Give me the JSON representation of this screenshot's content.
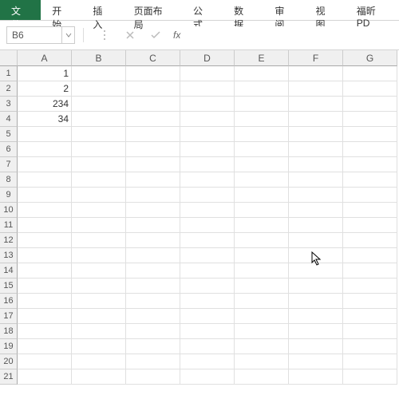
{
  "menu": {
    "file": "文件",
    "home": "开始",
    "insert": "插入",
    "layout": "页面布局",
    "formula": "公式",
    "data": "数据",
    "review": "审阅",
    "view": "视图",
    "foxit": "福昕PD"
  },
  "nameBox": "B6",
  "formulaBar": "",
  "columns": [
    "A",
    "B",
    "C",
    "D",
    "E",
    "F",
    "G"
  ],
  "rowCount": 21,
  "cells": {
    "A1": "1",
    "A2": "2",
    "A3": "234",
    "A4": "34"
  },
  "fxLabel": "fx"
}
